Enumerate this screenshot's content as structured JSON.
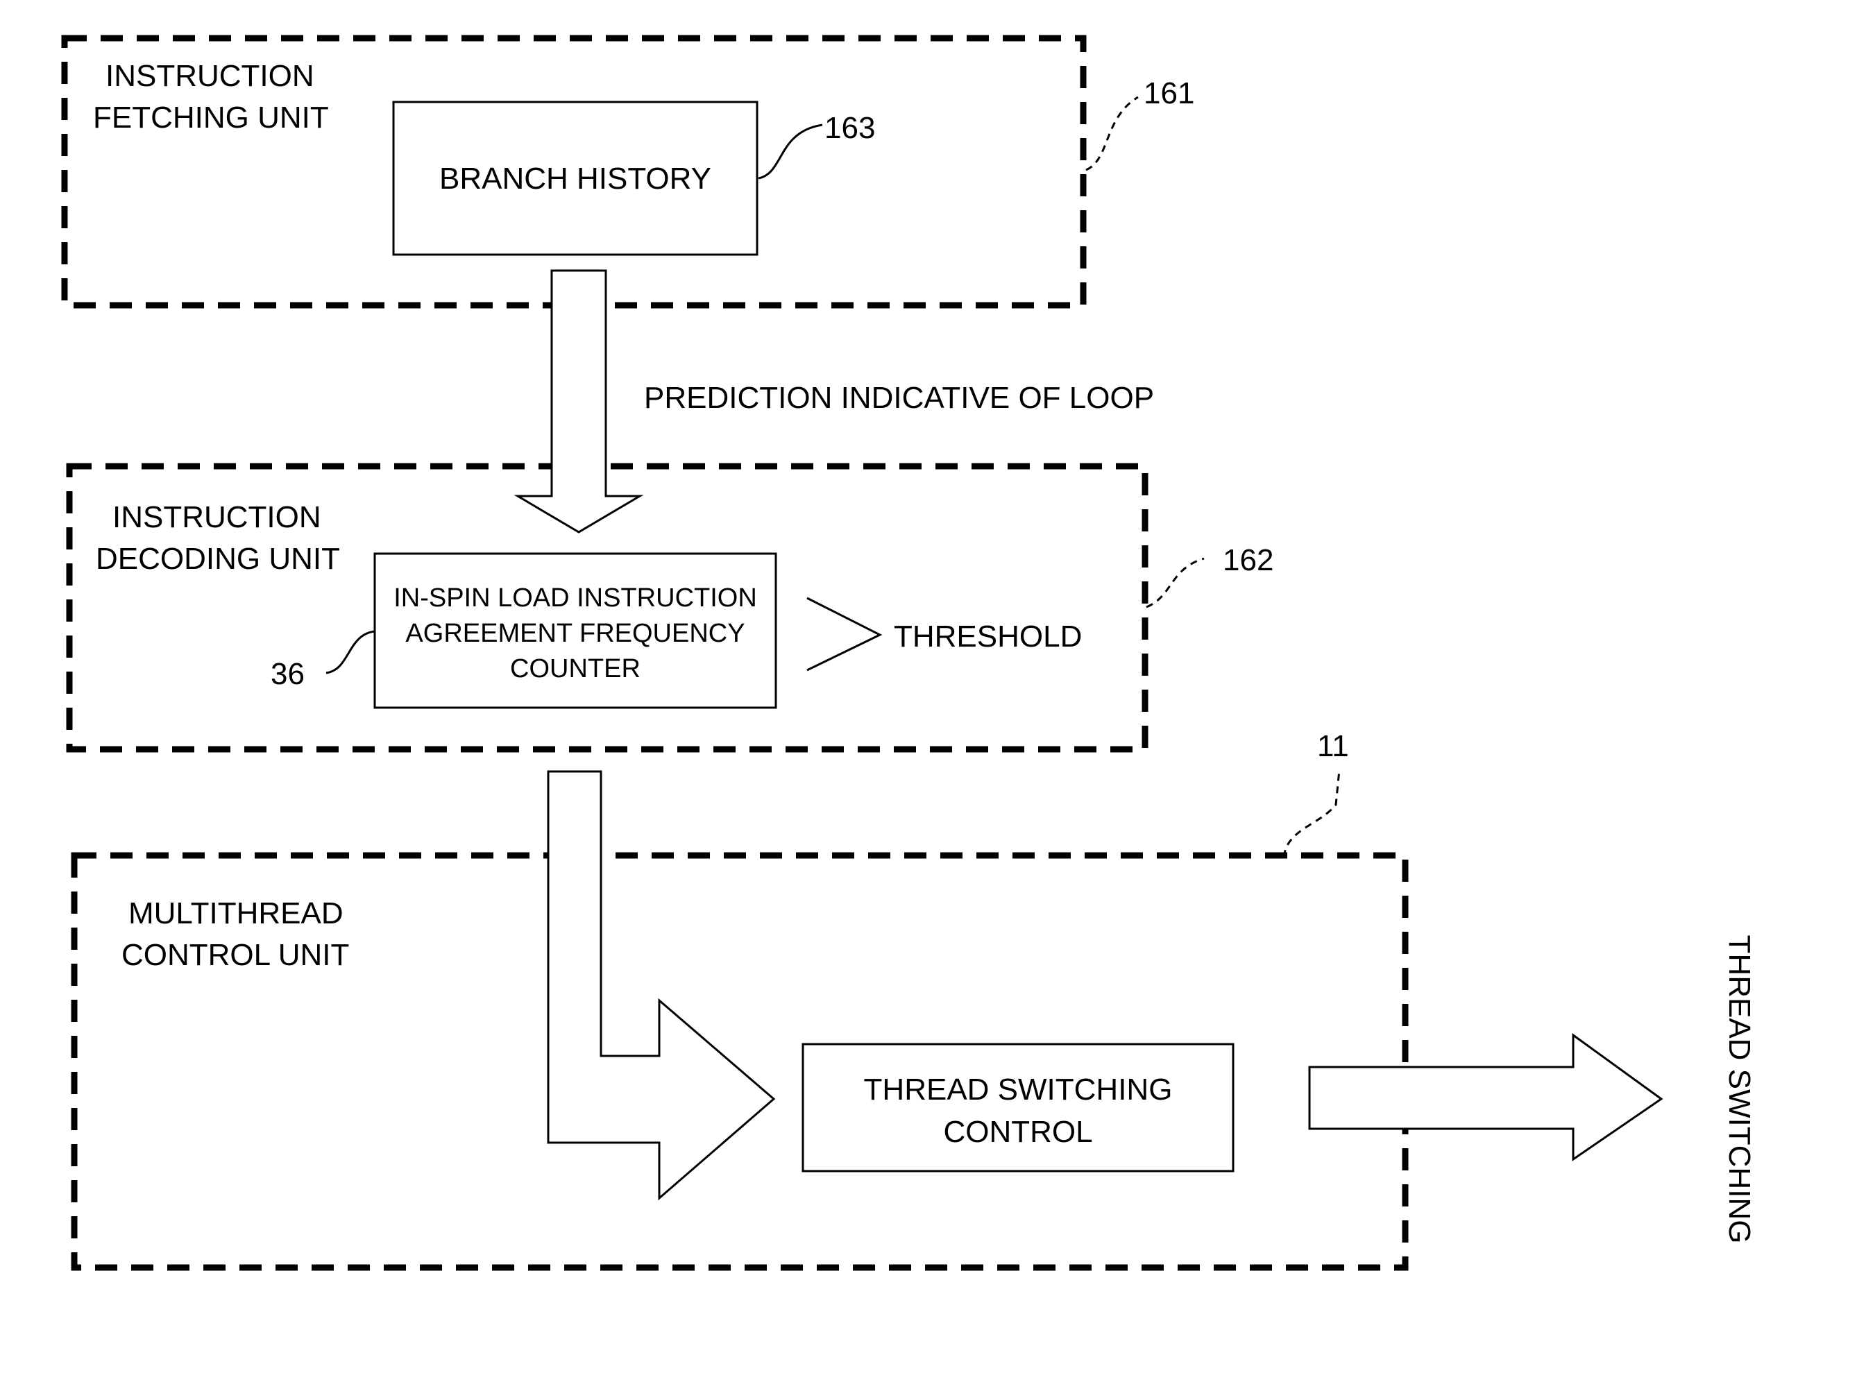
{
  "units": {
    "fetch": {
      "label_line1": "INSTRUCTION",
      "label_line2": "FETCHING UNIT",
      "ref": "161"
    },
    "decode": {
      "label_line1": "INSTRUCTION",
      "label_line2": "DECODING UNIT",
      "ref": "162"
    },
    "multithread": {
      "label_line1": "MULTITHREAD",
      "label_line2": "CONTROL UNIT",
      "ref": "11"
    }
  },
  "blocks": {
    "branch_history": {
      "label": "BRANCH HISTORY",
      "ref": "163"
    },
    "counter": {
      "line1": "IN-SPIN LOAD INSTRUCTION",
      "line2": "AGREEMENT FREQUENCY",
      "line3": "COUNTER",
      "ref": "36"
    },
    "thread_switching_control": {
      "line1": "THREAD SWITCHING",
      "line2": "CONTROL"
    }
  },
  "labels": {
    "prediction": "PREDICTION INDICATIVE OF LOOP",
    "comparison": ">",
    "threshold": "THRESHOLD",
    "output": "THREAD SWITCHING"
  }
}
